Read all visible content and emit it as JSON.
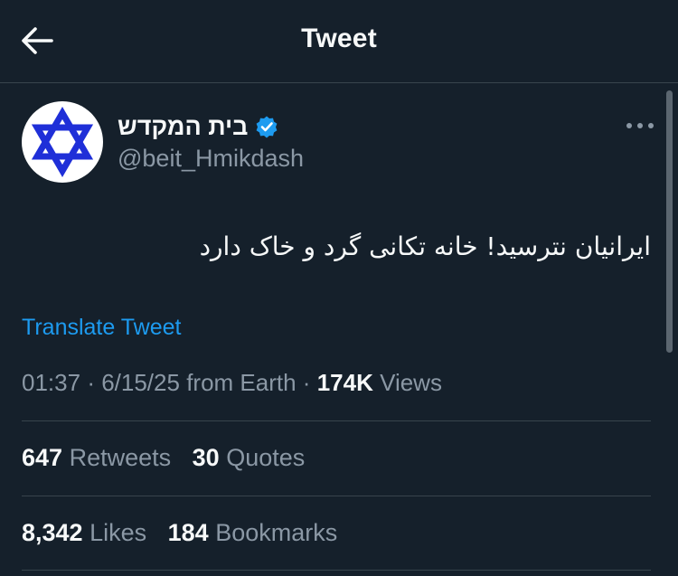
{
  "header": {
    "title": "Tweet"
  },
  "author": {
    "name": "בית המקדש",
    "handle": "@beit_Hmikdash"
  },
  "tweet": {
    "text": "ایرانیان نترسید! خانه تکانی گرد و خاک دارد",
    "translate_label": "Translate Tweet",
    "time": "01:37",
    "date": "6/15/25",
    "source": "from Earth",
    "views_count": "174K",
    "views_label": "Views"
  },
  "stats": {
    "retweets_count": "647",
    "retweets_label": "Retweets",
    "quotes_count": "30",
    "quotes_label": "Quotes",
    "likes_count": "8,342",
    "likes_label": "Likes",
    "bookmarks_count": "184",
    "bookmarks_label": "Bookmarks"
  },
  "icons": {
    "back": "arrow-left-icon",
    "verified": "verified-badge-icon",
    "more": "more-horizontal-icon",
    "avatar": "star-of-david-icon"
  },
  "colors": {
    "background": "#15202b",
    "text": "#f7f9f9",
    "muted": "#8b98a5",
    "link": "#1d9bf0",
    "divider": "#38444d",
    "verified": "#1d9bf0",
    "avatar_star": "#1f2fd8"
  }
}
